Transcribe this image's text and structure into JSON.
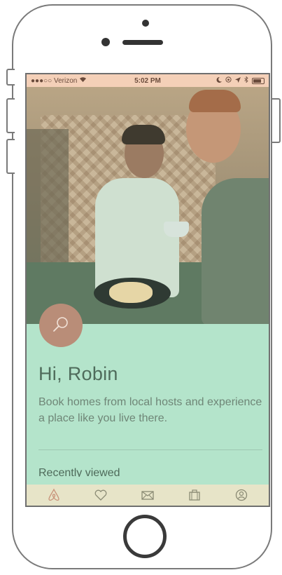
{
  "status_bar": {
    "carrier": "●●●○○ Verizon",
    "time": "5:02 PM"
  },
  "home": {
    "greeting": "Hi, Robin",
    "tagline": "Book homes from local hosts and experience a place like you live there.",
    "section_title": "Recently viewed"
  },
  "tab_bar": {
    "items": [
      {
        "name": "explore",
        "icon": "airbnb-logo-icon"
      },
      {
        "name": "saved",
        "icon": "heart-icon"
      },
      {
        "name": "inbox",
        "icon": "envelope-icon"
      },
      {
        "name": "trips",
        "icon": "suitcase-icon"
      },
      {
        "name": "profile",
        "icon": "user-icon"
      }
    ]
  },
  "colors": {
    "accent": "#b98d78",
    "panel": "#b4e4cb",
    "tab_bar": "#e7e4c8",
    "text": "#4f6b5b"
  }
}
